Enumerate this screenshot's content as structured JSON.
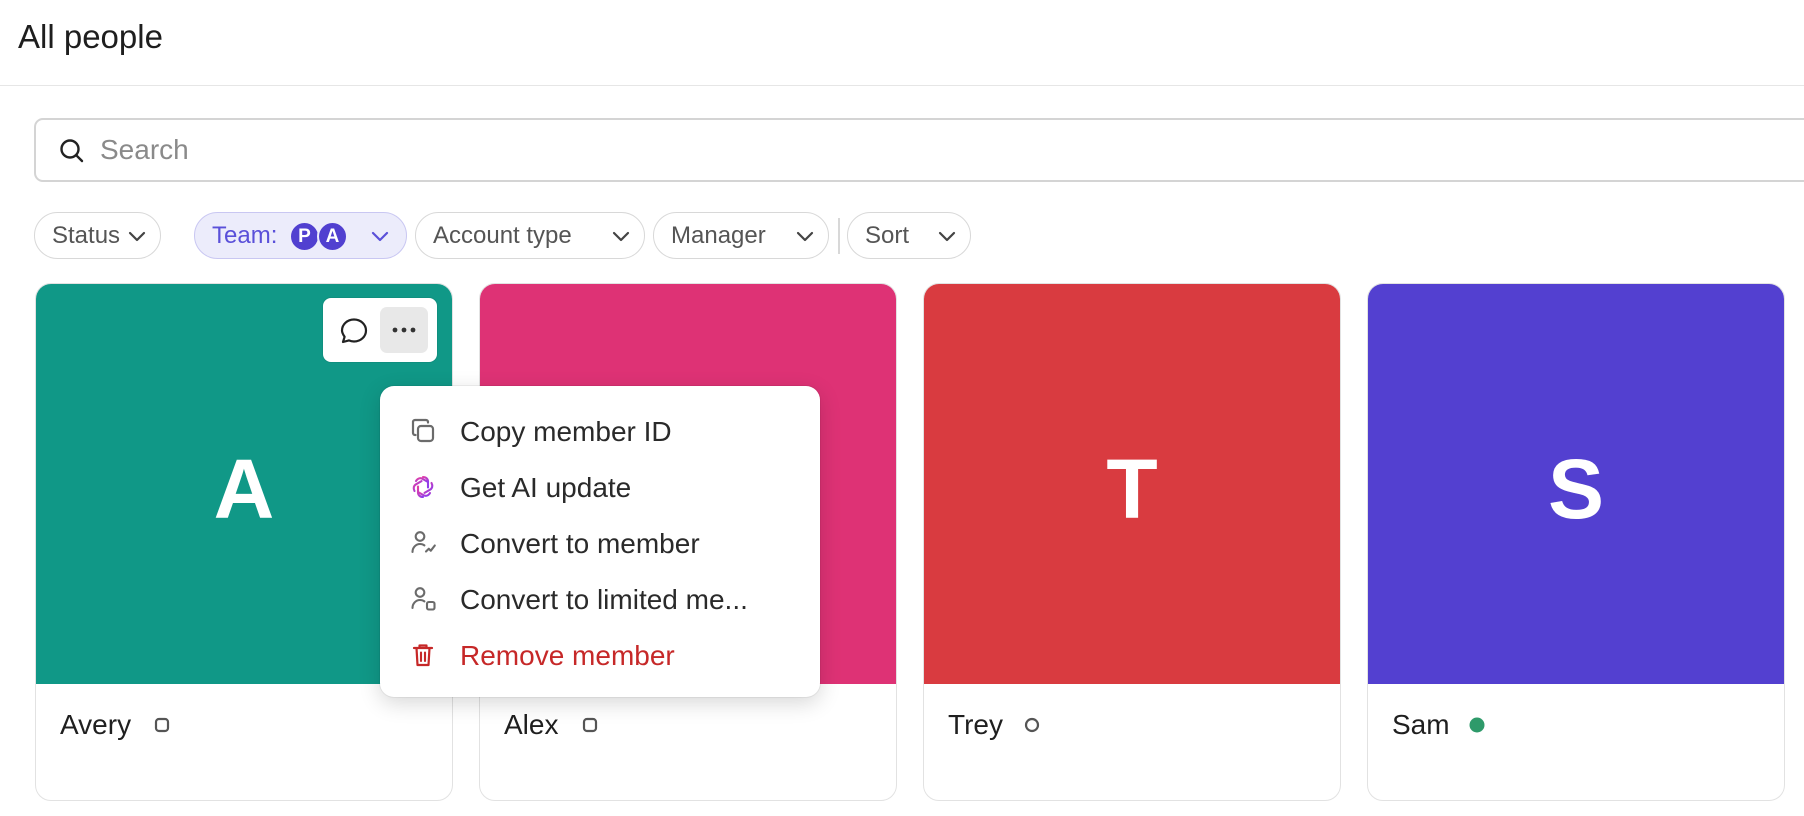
{
  "header": {
    "title": "All people"
  },
  "search": {
    "placeholder": "Search",
    "value": ""
  },
  "filters": {
    "status": "Status",
    "team": {
      "label": "Team:",
      "avatars": [
        "P",
        "A"
      ]
    },
    "account_type": "Account type",
    "manager": "Manager",
    "sort": "Sort"
  },
  "cards": [
    {
      "initial": "A",
      "name": "Avery",
      "color": "#109887",
      "status": "square-outline"
    },
    {
      "initial": "",
      "name": "Alex",
      "color": "#de3275",
      "status": "square-outline"
    },
    {
      "initial": "T",
      "name": "Trey",
      "color": "#d93b40",
      "status": "circle-outline"
    },
    {
      "initial": "S",
      "name": "Sam",
      "color": "#5340d0",
      "status": "online-dot"
    }
  ],
  "context_menu": {
    "items": [
      {
        "label": "Copy member ID",
        "icon": "copy-icon"
      },
      {
        "label": "Get AI update",
        "icon": "ai-icon"
      },
      {
        "label": "Convert to member",
        "icon": "user-convert-icon"
      },
      {
        "label": "Convert to limited me...",
        "icon": "limited-user-icon"
      },
      {
        "label": "Remove member",
        "icon": "trash-icon",
        "danger": true
      }
    ]
  },
  "colors": {
    "accent": "#5340d0",
    "danger": "#c62828",
    "online": "#2e9a6a"
  }
}
